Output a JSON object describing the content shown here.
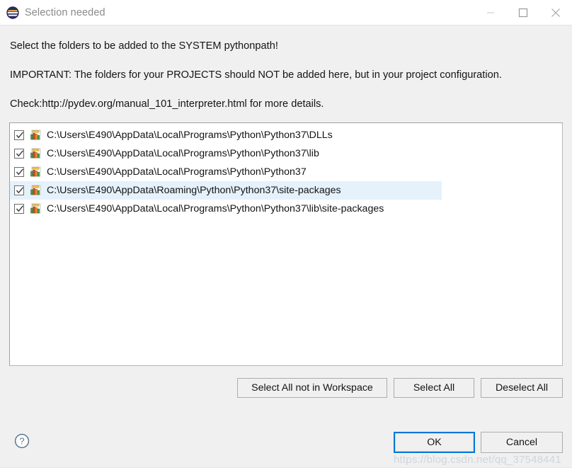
{
  "window": {
    "title": "Selection needed",
    "icon": "eclipse-icon",
    "controls": {
      "minimize": "minimize-icon",
      "maximize": "maximize-icon",
      "close": "close-icon"
    }
  },
  "instructions": {
    "line1": "Select the folders to be added to the SYSTEM pythonpath!",
    "line2": "IMPORTANT: The folders for your PROJECTS should NOT be added here, but in your project configuration.",
    "line3": "Check:http://pydev.org/manual_101_interpreter.html for more details."
  },
  "list": {
    "items": [
      {
        "label": "C:\\Users\\E490\\AppData\\Local\\Programs\\Python\\Python37\\DLLs",
        "checked": true,
        "selected": false,
        "icon": "library-folder-icon"
      },
      {
        "label": "C:\\Users\\E490\\AppData\\Local\\Programs\\Python\\Python37\\lib",
        "checked": true,
        "selected": false,
        "icon": "library-folder-icon"
      },
      {
        "label": "C:\\Users\\E490\\AppData\\Local\\Programs\\Python\\Python37",
        "checked": true,
        "selected": false,
        "icon": "library-folder-icon"
      },
      {
        "label": "C:\\Users\\E490\\AppData\\Roaming\\Python\\Python37\\site-packages",
        "checked": true,
        "selected": true,
        "icon": "library-folder-icon"
      },
      {
        "label": "C:\\Users\\E490\\AppData\\Local\\Programs\\Python\\Python37\\lib\\site-packages",
        "checked": true,
        "selected": false,
        "icon": "library-folder-icon"
      }
    ]
  },
  "buttons": {
    "select_all_not_in_workspace": "Select All not in Workspace",
    "select_all": "Select All",
    "deselect_all": "Deselect All",
    "ok": "OK",
    "cancel": "Cancel",
    "help": "help-icon"
  },
  "watermark": "https://blog.csdn.net/qq_37548441",
  "colors": {
    "body_background": "#f0f0f0",
    "titlebar_background": "#ffffff",
    "list_background": "#ffffff",
    "selection_highlight": "#e5f1fb",
    "focus_accent": "#0078d7",
    "title_text": "#8a8a8a",
    "button_border": "#adadad"
  }
}
